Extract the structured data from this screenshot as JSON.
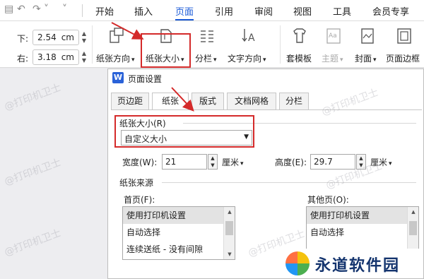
{
  "menu": {
    "items": [
      "开始",
      "插入",
      "页面",
      "引用",
      "审阅",
      "视图",
      "工具",
      "会员专享"
    ],
    "active_index": 2,
    "accent_color": "#1a5ad8"
  },
  "ribbon": {
    "margin_bottom": {
      "label": "下:",
      "value": "2.54",
      "unit": "cm"
    },
    "margin_right": {
      "label": "右:",
      "value": "3.18",
      "unit": "cm"
    },
    "buttons": [
      {
        "label": "纸张方向",
        "icon": "page-orientation-icon"
      },
      {
        "label": "纸张大小",
        "icon": "paper-size-icon"
      },
      {
        "label": "分栏",
        "icon": "columns-icon"
      },
      {
        "label": "文字方向",
        "icon": "text-direction-icon"
      },
      {
        "label": "套模板",
        "icon": "template-icon"
      },
      {
        "label": "主题",
        "icon": "theme-icon"
      },
      {
        "label": "封面",
        "icon": "cover-icon"
      },
      {
        "label": "页面边框",
        "icon": "page-border-icon"
      }
    ]
  },
  "dialog": {
    "title": "页面设置",
    "logo": "W",
    "tabs": [
      "页边距",
      "纸张",
      "版式",
      "文档网格",
      "分栏"
    ],
    "active_tab": 1,
    "paper_size": {
      "label": "纸张大小(R)",
      "selected": "自定义大小"
    },
    "width": {
      "label": "宽度(W):",
      "value": "21",
      "unit": "厘米"
    },
    "height": {
      "label": "高度(E):",
      "value": "29.7",
      "unit": "厘米"
    },
    "paper_source": {
      "label": "纸张来源"
    },
    "first_page": {
      "label": "首页(F):",
      "items": [
        "使用打印机设置",
        "自动选择",
        "连续送纸 - 没有间隙"
      ]
    },
    "other_pages": {
      "label": "其他页(O):",
      "items": [
        "使用打印机设置",
        "自动选择"
      ]
    }
  },
  "watermark": "@打印机卫士",
  "brand": {
    "name": "永道软件园"
  },
  "colors": {
    "highlight_red": "#d42a2a"
  }
}
